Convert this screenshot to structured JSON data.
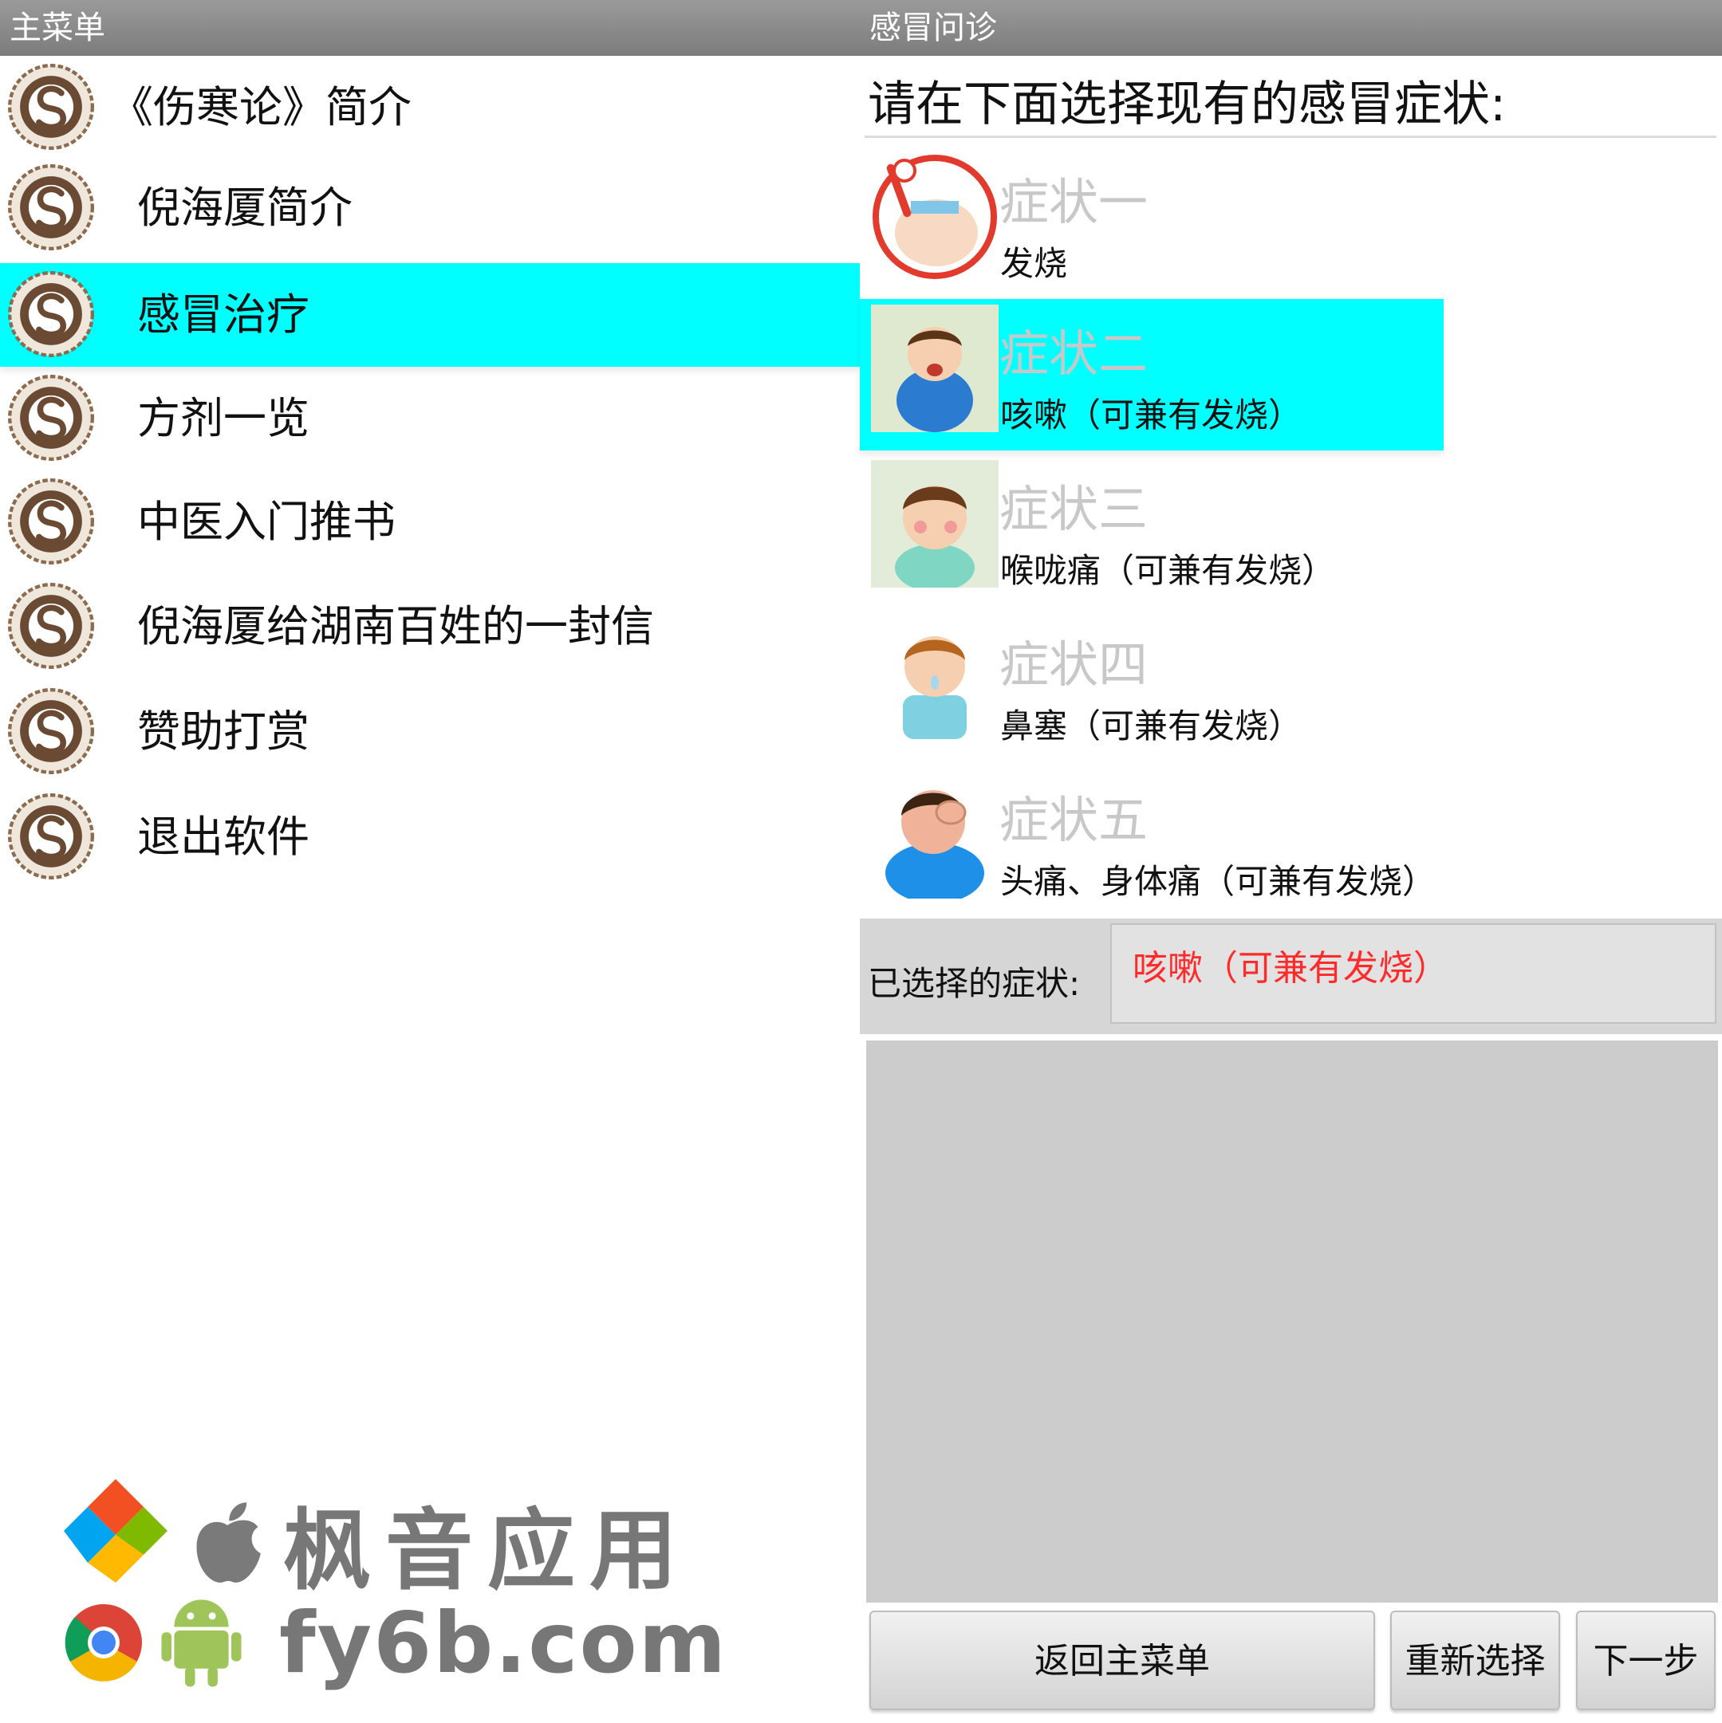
{
  "left": {
    "title": "主菜单",
    "items": [
      {
        "label": "《伤寒论》简介",
        "selected": false
      },
      {
        "label": "倪海厦简介",
        "selected": false
      },
      {
        "label": "感冒治疗",
        "selected": true
      },
      {
        "label": "方剂一览",
        "selected": false
      },
      {
        "label": "中医入门推书",
        "selected": false
      },
      {
        "label": "倪海厦给湖南百姓的一封信",
        "selected": false
      },
      {
        "label": "赞助打赏",
        "selected": false
      },
      {
        "label": "退出软件",
        "selected": false
      }
    ],
    "watermark": {
      "line1": "枫音应用",
      "line2": "fy6b.com"
    }
  },
  "right": {
    "title": "感冒问诊",
    "instruction": "请在下面选择现有的感冒症状:",
    "symptoms": [
      {
        "title": "症状一",
        "desc": "发烧",
        "icon": "fever-child-icon"
      },
      {
        "title": "症状二",
        "desc": "咳嗽（可兼有发烧）",
        "icon": "cough-child-icon"
      },
      {
        "title": "症状三",
        "desc": "喉咙痛（可兼有发烧）",
        "icon": "sore-throat-child-icon"
      },
      {
        "title": "症状四",
        "desc": "鼻塞（可兼有发烧）",
        "icon": "stuffy-nose-child-icon"
      },
      {
        "title": "症状五",
        "desc": "头痛、身体痛（可兼有发烧）",
        "icon": "headache-child-icon"
      }
    ],
    "selected_index": 1,
    "selected_label": "已选择的症状:",
    "selected_value": "咳嗽（可兼有发烧）",
    "buttons": {
      "back": "返回主菜单",
      "reset": "重新选择",
      "next": "下一步"
    }
  },
  "colors": {
    "highlight": "#00ffff",
    "title_bar": "#8a8a8a",
    "selected_text": "#ff2a2a"
  }
}
